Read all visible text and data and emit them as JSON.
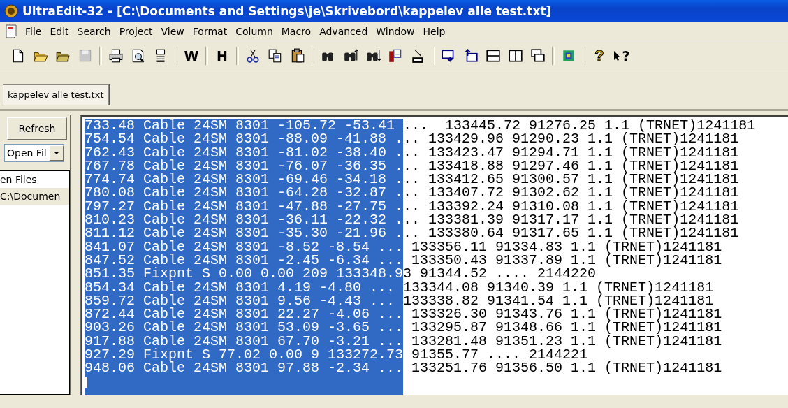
{
  "window": {
    "title": "UltraEdit-32 - [C:\\Documents and Settings\\je\\Skrivebord\\kappelev alle test.txt]"
  },
  "menu": [
    "File",
    "Edit",
    "Search",
    "Project",
    "View",
    "Format",
    "Column",
    "Macro",
    "Advanced",
    "Window",
    "Help"
  ],
  "toolbar": [
    {
      "kind": "new"
    },
    {
      "kind": "open"
    },
    {
      "kind": "open-recent"
    },
    {
      "kind": "save",
      "disabled": true
    },
    {
      "kind": "separator"
    },
    {
      "kind": "print"
    },
    {
      "kind": "preview"
    },
    {
      "kind": "page"
    },
    {
      "kind": "separator"
    },
    {
      "kind": "letter",
      "label": "W"
    },
    {
      "kind": "separator"
    },
    {
      "kind": "letter",
      "label": "H"
    },
    {
      "kind": "separator"
    },
    {
      "kind": "cut"
    },
    {
      "kind": "copy"
    },
    {
      "kind": "paste"
    },
    {
      "kind": "separator"
    },
    {
      "kind": "find"
    },
    {
      "kind": "find-up"
    },
    {
      "kind": "find-down"
    },
    {
      "kind": "replace"
    },
    {
      "kind": "goto"
    },
    {
      "kind": "separator"
    },
    {
      "kind": "window-next"
    },
    {
      "kind": "window-prev"
    },
    {
      "kind": "split-h"
    },
    {
      "kind": "split-v"
    },
    {
      "kind": "cascade"
    },
    {
      "kind": "separator"
    },
    {
      "kind": "palette"
    },
    {
      "kind": "separator"
    },
    {
      "kind": "help",
      "label": "?"
    },
    {
      "kind": "context-help",
      "label": "?"
    }
  ],
  "tabs": [
    {
      "label": "kappelev alle test.txt",
      "selected": true
    }
  ],
  "side_panel": {
    "refresh_button": "Refresh",
    "open_files_select": "Open Fil",
    "list": [
      {
        "label": "en Files",
        "selected": false
      },
      {
        "label": "C:\\Documen",
        "selected": true
      }
    ]
  },
  "editor": {
    "lines": [
      {
        "selected_text": "733.48 Cable 24SM 8301 -105.72 -53.41",
        "text": "...  133445.72 91276.25 1.1 (TRNET)1241181"
      },
      {
        "selected_text": "754.54 Cable 24SM 8301 -88.09 -41.88 .",
        "text": ".. 133429.96 91290.23 1.1 (TRNET)1241181"
      },
      {
        "selected_text": "762.43 Cable 24SM 8301 -81.02 -38.40 .",
        "text": ".. 133423.47 91294.71 1.1 (TRNET)1241181"
      },
      {
        "selected_text": "767.78 Cable 24SM 8301 -76.07 -36.35 .",
        "text": ".. 133418.88 91297.46 1.1 (TRNET)1241181"
      },
      {
        "selected_text": "774.74 Cable 24SM 8301 -69.46 -34.18 .",
        "text": ".. 133412.65 91300.57 1.1 (TRNET)1241181"
      },
      {
        "selected_text": "780.08 Cable 24SM 8301 -64.28 -32.87 .",
        "text": ".. 133407.72 91302.62 1.1 (TRNET)1241181"
      },
      {
        "selected_text": "797.27 Cable 24SM 8301 -47.88 -27.75 .",
        "text": ".. 133392.24 91310.08 1.1 (TRNET)1241181"
      },
      {
        "selected_text": "810.23 Cable 24SM 8301 -36.11 -22.32 .",
        "text": ".. 133381.39 91317.17 1.1 (TRNET)1241181"
      },
      {
        "selected_text": "811.12 Cable 24SM 8301 -35.30 -21.96 .",
        "text": ".. 133380.64 91317.65 1.1 (TRNET)1241181"
      },
      {
        "selected_text": "841.07 Cable 24SM 8301 -8.52 -8.54 ...",
        "text": " 133356.11 91334.83 1.1 (TRNET)1241181"
      },
      {
        "selected_text": "847.52 Cable 24SM 8301 -2.45 -6.34 ...",
        "text": " 133350.43 91337.89 1.1 (TRNET)1241181"
      },
      {
        "selected_text": "851.35 Fixpnt S 0.00 0.00 209 133348.9",
        "text": "3 91344.52 .... 2144220"
      },
      {
        "selected_text": "854.34 Cable 24SM 8301 4.19 -4.80 ...",
        "text": "133344.08 91340.39 1.1 (TRNET)1241181"
      },
      {
        "selected_text": "859.72 Cable 24SM 8301 9.56 -4.43 ...",
        "text": "133338.82 91341.54 1.1 (TRNET)1241181"
      },
      {
        "selected_text": "872.44 Cable 24SM 8301 22.27 -4.06 ...",
        "text": " 133326.30 91343.76 1.1 (TRNET)1241181"
      },
      {
        "selected_text": "903.26 Cable 24SM 8301 53.09 -3.65 ...",
        "text": " 133295.87 91348.66 1.1 (TRNET)1241181"
      },
      {
        "selected_text": "917.88 Cable 24SM 8301 67.70 -3.21 ...",
        "text": " 133281.48 91351.23 1.1 (TRNET)1241181"
      },
      {
        "selected_text": "927.29 Fixpnt S 77.02 0.00 9 133272.73",
        "text": " 91355.77 .... 2144221"
      },
      {
        "selected_text": "948.06 Cable 24SM 8301 97.88 -2.34 ...",
        "text": " 133251.76 91356.50 1.1 (TRNET)1241181"
      },
      {
        "kind": "cursor"
      }
    ]
  }
}
